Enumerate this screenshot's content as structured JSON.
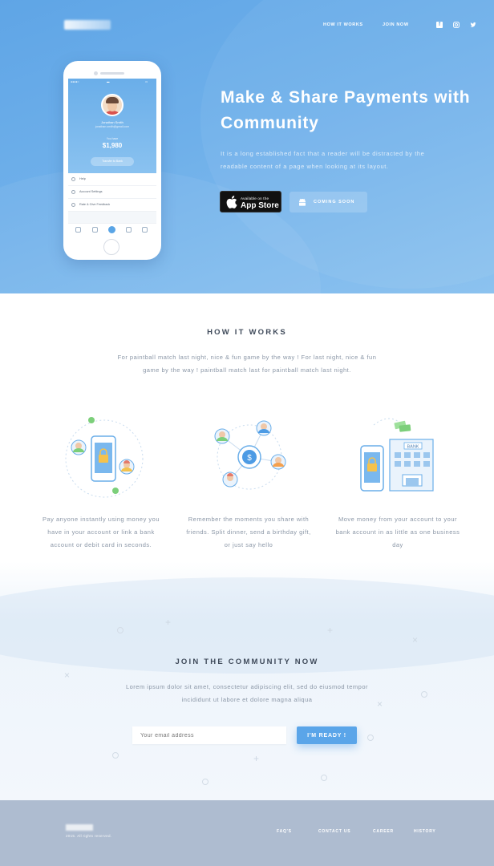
{
  "nav": {
    "links": [
      "HOW IT WORKS",
      "JOIN NOW"
    ],
    "social_icons": [
      "facebook-icon",
      "instagram-icon",
      "twitter-icon"
    ]
  },
  "hero": {
    "title": "Make & Share Payments with Community",
    "description": "It is a long established fact that a reader will be distracted by the readable content of a page when looking at its layout.",
    "appstore_small": "Available on the",
    "appstore_big": "App Store",
    "coming_soon": "COMING SOON"
  },
  "phone": {
    "user_name": "Jonathan Smith",
    "user_email": "jonathan.smith@gmail.com",
    "balance_label": "You have",
    "balance_value": "$1,980",
    "transfer_label": "Transfer to Bank",
    "menu": [
      "Help",
      "Account Settings",
      "Rate & Give Feedback"
    ]
  },
  "how": {
    "title": "HOW IT WORKS",
    "description": "For paintball match last night, nice & fun game by the way ! For last night, nice & fun game by the way ! paintball match last for paintball match last night.",
    "features": [
      "Pay anyone instantly using money you have in your account or link a bank account or debit card in seconds.",
      "Remember the moments you share with friends. Split dinner, send a birthday gift, or just say hello",
      "Move money from your account to your bank account in as little as one business day"
    ]
  },
  "join": {
    "title": "JOIN THE COMMUNITY NOW",
    "description": "Lorem ipsum dolor sit amet, consectetur adipiscing elit, sed do eiusmod tempor incididunt ut labore et dolore magna aliqua",
    "email_placeholder": "Your email address",
    "button": "I'M READY !"
  },
  "footer": {
    "copyright": "2015. All rights reserved.",
    "links": [
      "FAQ'S",
      "CONTACT US",
      "CAREER",
      "HISTORY"
    ]
  },
  "colors": {
    "brand_blue": "#5aa5e9",
    "hero_top": "#5fa5e6",
    "footer_bg": "#aebcd0",
    "accent_green": "#7ccf7a"
  }
}
